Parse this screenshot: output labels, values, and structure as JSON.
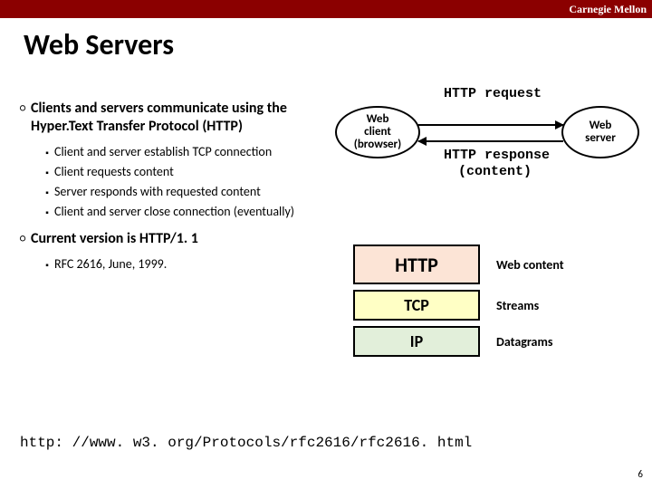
{
  "banner": "Carnegie Mellon",
  "title": "Web Servers",
  "points": {
    "p1": "Clients and servers communicate using  the Hyper.Text Transfer Protocol (HTTP)",
    "p1subs": [
      "Client and server establish TCP connection",
      "Client requests content",
      "Server responds with requested content",
      "Client and server close connection (eventually)"
    ],
    "p2": "Current version is HTTP/1. 1",
    "p2subs": [
      "RFC 2616, June, 1999."
    ]
  },
  "diagram": {
    "client": "Web\nclient\n(browser)",
    "server": "Web\nserver",
    "req": "HTTP request",
    "resp1": "HTTP response",
    "resp2": "(content)"
  },
  "stack": {
    "layers": [
      {
        "name": "HTTP",
        "desc": "Web content"
      },
      {
        "name": "TCP",
        "desc": "Streams"
      },
      {
        "name": "IP",
        "desc": "Datagrams"
      }
    ]
  },
  "url": "http: //www. w3. org/Protocols/rfc2616/rfc2616. html",
  "page": "6"
}
